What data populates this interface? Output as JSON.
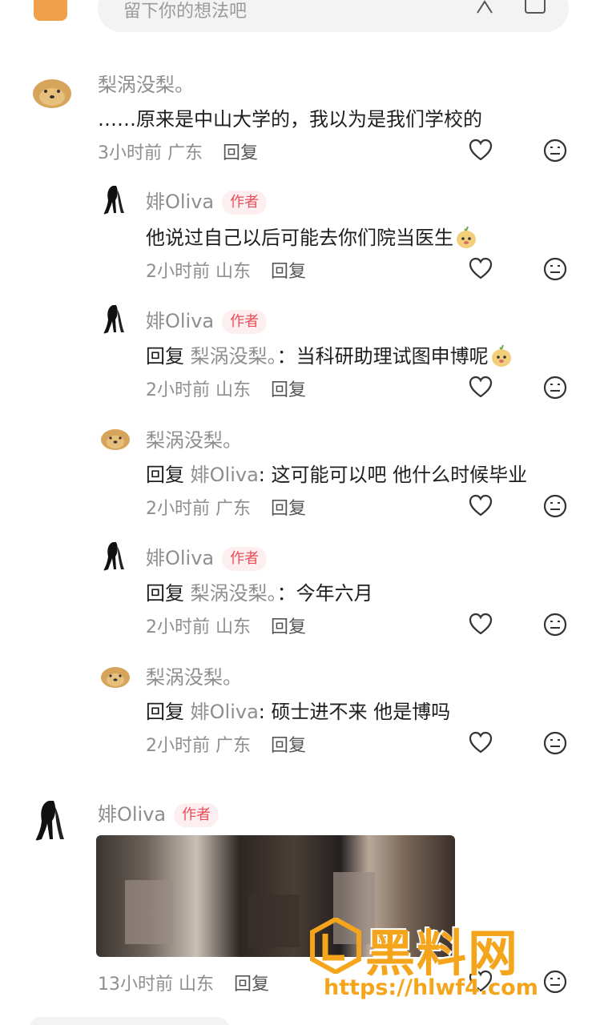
{
  "top_input": {
    "placeholder": "留下你的想法吧"
  },
  "badge_author": "作者",
  "reply_label": "回复",
  "comments": [
    {
      "name": "梨涡没梨。",
      "text": "……原来是中山大学的，我以为是我们学校的",
      "time": "3小时前",
      "location": "广东"
    },
    {
      "name": "婔Oliva",
      "text": "他说过自己以后可能去你们院当医生",
      "time": "2小时前",
      "location": "山东"
    },
    {
      "name": "婔Oliva",
      "reply_prefix": "回复",
      "reply_to": "梨涡没梨。",
      "text": "：当科研助理试图申博呢",
      "time": "2小时前",
      "location": "山东"
    },
    {
      "name": "梨涡没梨。",
      "reply_prefix": "回复",
      "reply_to": "婔Oliva",
      "text": ": 这可能可以吧  他什么时候毕业",
      "time": "2小时前",
      "location": "广东"
    },
    {
      "name": "婔Oliva",
      "reply_prefix": "回复",
      "reply_to": "梨涡没梨。",
      "text": "：今年六月",
      "time": "2小时前",
      "location": "山东"
    },
    {
      "name": "梨涡没梨。",
      "reply_prefix": "回复",
      "reply_to": "婔Oliva",
      "text": ": 硕士进不来 他是博吗",
      "time": "2小时前",
      "location": "广东"
    },
    {
      "name": "婔Oliva",
      "time": "13小时前",
      "location": "山东"
    }
  ],
  "watermark": {
    "title": "黑料网",
    "url": "https://hlwf4.com"
  },
  "colors": {
    "badge_bg": "#fdeef0",
    "badge_text": "#e8505b",
    "muted": "#8e8e8e",
    "watermark": "#f4a51c"
  }
}
